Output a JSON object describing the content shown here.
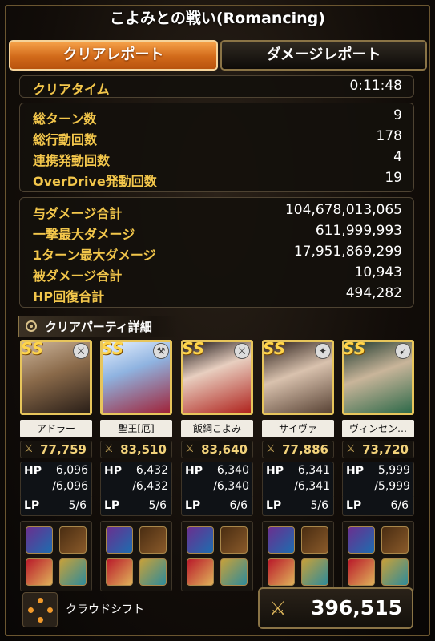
{
  "header": {
    "title": "こよみとの戦い(Romancing)"
  },
  "tabs": [
    {
      "label": "クリアレポート",
      "active": true
    },
    {
      "label": "ダメージレポート",
      "active": false
    }
  ],
  "clear_time": {
    "label": "クリアタイム",
    "value": "0:11:48"
  },
  "stats_a": [
    {
      "label": "総ターン数",
      "value": "9"
    },
    {
      "label": "総行動回数",
      "value": "178"
    },
    {
      "label": "連携発動回数",
      "value": "4"
    },
    {
      "label": "OverDrive発動回数",
      "value": "19"
    }
  ],
  "stats_b": [
    {
      "label": "与ダメージ合計",
      "value": "104,678,013,065"
    },
    {
      "label": "一撃最大ダメージ",
      "value": "611,999,993"
    },
    {
      "label": "1ターン最大ダメージ",
      "value": "17,951,869,299"
    },
    {
      "label": "被ダメージ合計",
      "value": "10,943"
    },
    {
      "label": "HP回復合計",
      "value": "494,282"
    }
  ],
  "party_header": "クリアパーティ詳細",
  "party": [
    {
      "name": "アドラー",
      "power": "77,759",
      "hp": "6,096",
      "hp_max": "/6,096",
      "lp": "5/6",
      "weapon_icon": "sword-icon",
      "accent": "#8a6a4a"
    },
    {
      "name": "聖王[厄]",
      "power": "83,510",
      "hp": "6,432",
      "hp_max": "/6,432",
      "lp": "5/6",
      "weapon_icon": "axe-icon",
      "accent": "#8fb3e0"
    },
    {
      "name": "飯綱こよみ",
      "power": "83,640",
      "hp": "6,340",
      "hp_max": "/6,340",
      "lp": "6/6",
      "weapon_icon": "sword-icon",
      "accent": "#b0241e"
    },
    {
      "name": "サイヴァ",
      "power": "77,886",
      "hp": "6,341",
      "hp_max": "/6,341",
      "lp": "5/6",
      "weapon_icon": "staff-icon",
      "accent": "#5a4436"
    },
    {
      "name": "ヴィンセン…",
      "power": "73,720",
      "hp": "5,999",
      "hp_max": "/5,999",
      "lp": "6/6",
      "weapon_icon": "gun-icon",
      "accent": "#2f6a4a"
    }
  ],
  "labels": {
    "hp": "HP",
    "lp": "LP",
    "rank": "SS"
  },
  "footer": {
    "formation": "クラウドシフト",
    "total_power": "396,515"
  }
}
